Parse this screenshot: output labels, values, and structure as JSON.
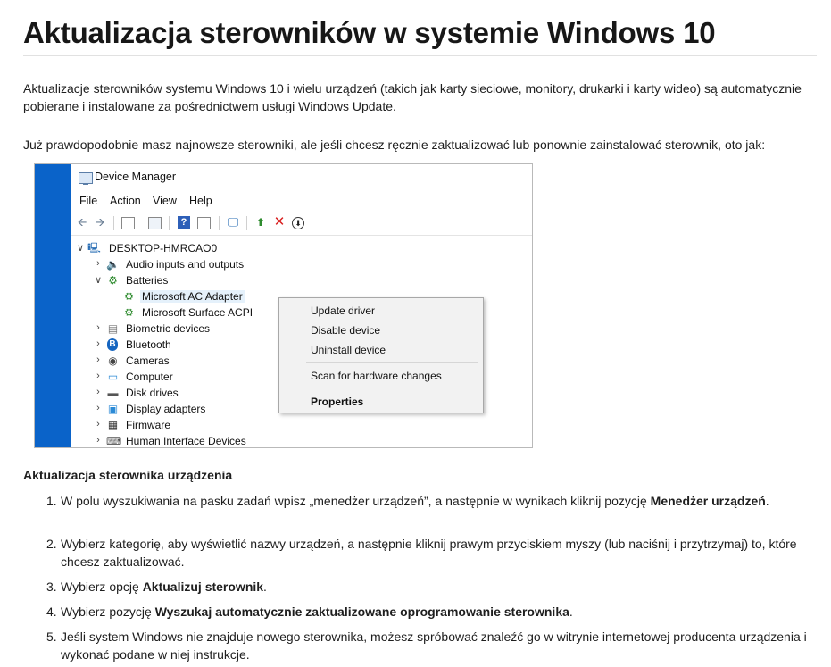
{
  "page": {
    "title": "Aktualizacja sterowników w systemie Windows 10",
    "intro": "Aktualizacje sterowników systemu Windows 10 i wielu urządzeń (takich jak karty sieciowe, monitory, drukarki i karty wideo) są automatycznie pobierane i instalowane za pośrednictwem usługi Windows Update.",
    "intro2": "Już prawdopodobnie masz najnowsze sterowniki, ale jeśli chcesz ręcznie zaktualizować lub ponownie zainstalować sterownik, oto jak:"
  },
  "device_manager": {
    "title": "Device Manager",
    "menu": [
      "File",
      "Action",
      "View",
      "Help"
    ],
    "toolbar_icons": [
      "back-icon",
      "forward-icon",
      "properties-panel-icon",
      "console-tree-icon",
      "help-icon",
      "action-pane-icon",
      "monitor-icon",
      "update-driver-icon",
      "uninstall-icon",
      "disable-icon"
    ],
    "tree": {
      "root": "DESKTOP-HMRCAO0",
      "items": [
        {
          "label": "Audio inputs and outputs",
          "icon": "speaker-icon",
          "expanded": false
        },
        {
          "label": "Batteries",
          "icon": "battery-icon",
          "expanded": true
        },
        {
          "label": "Microsoft AC Adapter",
          "icon": "battery-icon",
          "child": true,
          "selected": true
        },
        {
          "label": "Microsoft Surface ACPI",
          "icon": "battery-icon",
          "child": true
        },
        {
          "label": "Biometric devices",
          "icon": "biometric-icon",
          "expanded": false
        },
        {
          "label": "Bluetooth",
          "icon": "bluetooth-icon",
          "expanded": false
        },
        {
          "label": "Cameras",
          "icon": "camera-icon",
          "expanded": false
        },
        {
          "label": "Computer",
          "icon": "computer-icon",
          "expanded": false
        },
        {
          "label": "Disk drives",
          "icon": "disk-icon",
          "expanded": false
        },
        {
          "label": "Display adapters",
          "icon": "display-icon",
          "expanded": false
        },
        {
          "label": "Firmware",
          "icon": "chip-icon",
          "expanded": false
        },
        {
          "label": "Human Interface Devices",
          "icon": "hid-icon",
          "expanded": false
        }
      ]
    },
    "context_menu": {
      "update": "Update driver",
      "disable": "Disable device",
      "uninstall": "Uninstall device",
      "scan": "Scan for hardware changes",
      "properties": "Properties"
    }
  },
  "section": {
    "title": "Aktualizacja sterownika urządzenia",
    "steps": [
      {
        "num": "1.",
        "pre": "W polu wyszukiwania na pasku zadań wpisz „menedżer urządzeń”, a następnie w wynikach kliknij pozycję ",
        "bold": "Menedżer urządzeń",
        "post": "."
      },
      {
        "num": "2.",
        "pre": "Wybierz kategorię, aby wyświetlić nazwy urządzeń, a następnie kliknij prawym przyciskiem myszy (lub naciśnij i przytrzymaj) to, które chcesz zaktualizować.",
        "bold": "",
        "post": ""
      },
      {
        "num": "3.",
        "pre": "Wybierz opcję ",
        "bold": "Aktualizuj sterownik",
        "post": "."
      },
      {
        "num": "4.",
        "pre": "Wybierz pozycję ",
        "bold": "Wyszukaj automatycznie zaktualizowane oprogramowanie sterownika",
        "post": "."
      },
      {
        "num": "5.",
        "pre": "Jeśli system Windows nie znajduje nowego sterownika, możesz spróbować znaleźć go w witrynie internetowej producenta urządzenia i wykonać podane w niej instrukcje.",
        "bold": "",
        "post": ""
      }
    ]
  }
}
